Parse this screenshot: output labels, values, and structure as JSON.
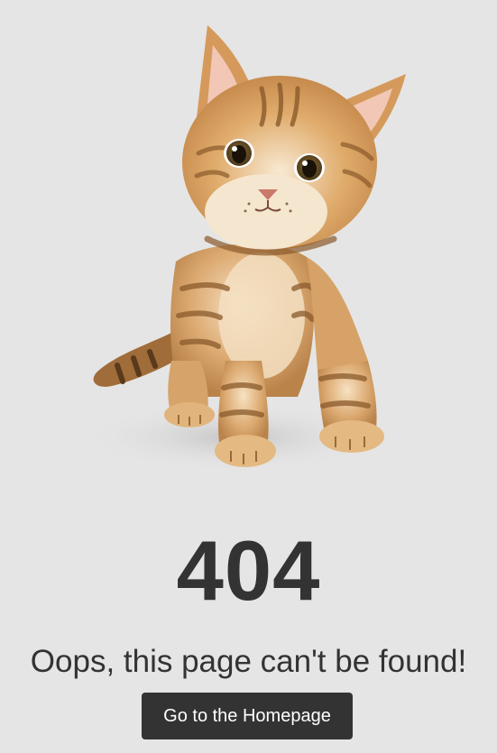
{
  "error": {
    "code": "404",
    "message": "Oops, this page can't be found!"
  },
  "actions": {
    "home_label": "Go to the Homepage"
  },
  "colors": {
    "background": "#e5e5e5",
    "text": "#333333",
    "button_bg": "#333333",
    "button_text": "#ffffff"
  },
  "illustration": {
    "subject": "kitten-illustration"
  }
}
